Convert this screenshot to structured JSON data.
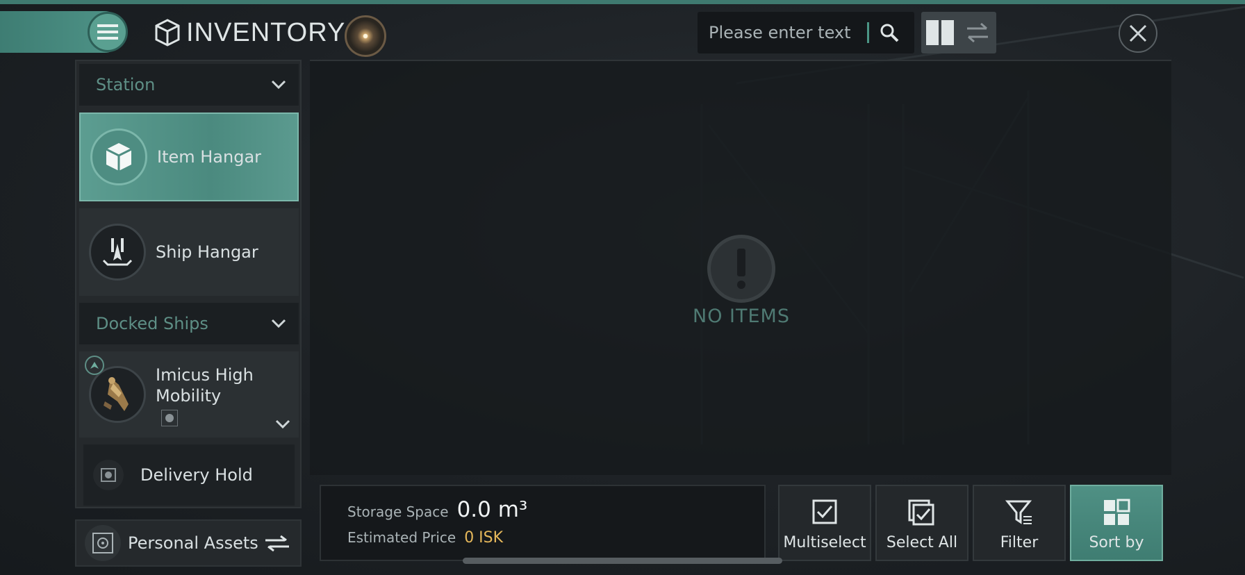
{
  "header": {
    "title": "INVENTORY",
    "search_placeholder": "Please enter text"
  },
  "sidebar": {
    "station_section": "Station",
    "items": [
      {
        "label": "Item Hangar",
        "active": true
      },
      {
        "label": "Ship Hangar",
        "active": false
      }
    ],
    "docked_section": "Docked Ships",
    "ship": {
      "name": "Imicus High Mobility"
    },
    "delivery": "Delivery Hold",
    "personal_assets": "Personal Assets"
  },
  "main": {
    "empty_text": "NO ITEMS"
  },
  "storage": {
    "space_label": "Storage Space",
    "space_value": "0.0 m³",
    "price_label": "Estimated Price",
    "price_value": "0 ISK"
  },
  "actions": {
    "multiselect": "Multiselect",
    "select_all": "Select All",
    "filter": "Filter",
    "sort_by": "Sort by"
  },
  "colors": {
    "accent": "#4f9488",
    "price": "#e6b85b",
    "panel": "#25292c"
  }
}
